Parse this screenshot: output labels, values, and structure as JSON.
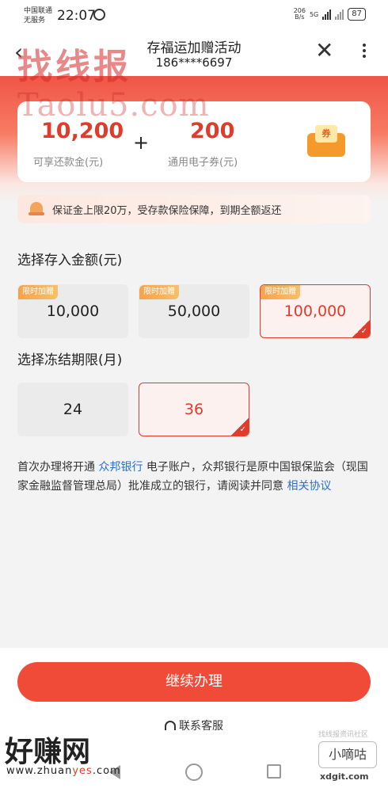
{
  "status_bar": {
    "carrier_line1": "中国联通",
    "carrier_line2": "无服务",
    "time": "22:07",
    "speed": "206",
    "speed_unit": "B/s",
    "network": "5G",
    "battery": "87"
  },
  "header": {
    "title": "存福运加赠活动",
    "subtitle": "186****6697"
  },
  "watermarks": {
    "top": "找线报",
    "mid": "Taolu5.com",
    "bottom": "好赚网",
    "bottom_url_a": "www.zhuan",
    "bottom_url_b": "yes",
    "bottom_url_c": ".com",
    "right_small": "找线报资讯社区",
    "right_box": "小嘀咕",
    "right_url": "xdgit.com"
  },
  "summary": {
    "amount1": "10,200",
    "label1": "可享还款金(元)",
    "plus": "+",
    "amount2": "200",
    "label2": "通用电子券(元)",
    "coupon_icon_text": "券"
  },
  "notice": {
    "text": "保证金上限20万，受存款保险保障，到期全额返还"
  },
  "deposit": {
    "title": "选择存入金额(元)",
    "options": [
      {
        "tag": "限时加赠",
        "value": "10,000",
        "selected": false
      },
      {
        "tag": "限时加赠",
        "value": "50,000",
        "selected": false
      },
      {
        "tag": "限时加赠",
        "value": "100,000",
        "selected": true
      }
    ]
  },
  "term": {
    "title": "选择冻结期限(月)",
    "options": [
      {
        "value": "24",
        "selected": false
      },
      {
        "value": "36",
        "selected": true
      }
    ]
  },
  "agreement": {
    "part1": "首次办理将开通 ",
    "bank_link": "众邦银行",
    "part2": " 电子账户，众邦银行是原中国银保监会（现国家金融监督管理总局）批准成立的银行，请阅读并同意 ",
    "protocol_link": "相关协议"
  },
  "footer": {
    "cta": "继续办理",
    "service": "联系客服"
  },
  "colors": {
    "brand_red": "#e03c2b",
    "button_red": "#f04a38",
    "link_blue": "#2a6fd0",
    "tag_orange": "#f7a24a"
  }
}
